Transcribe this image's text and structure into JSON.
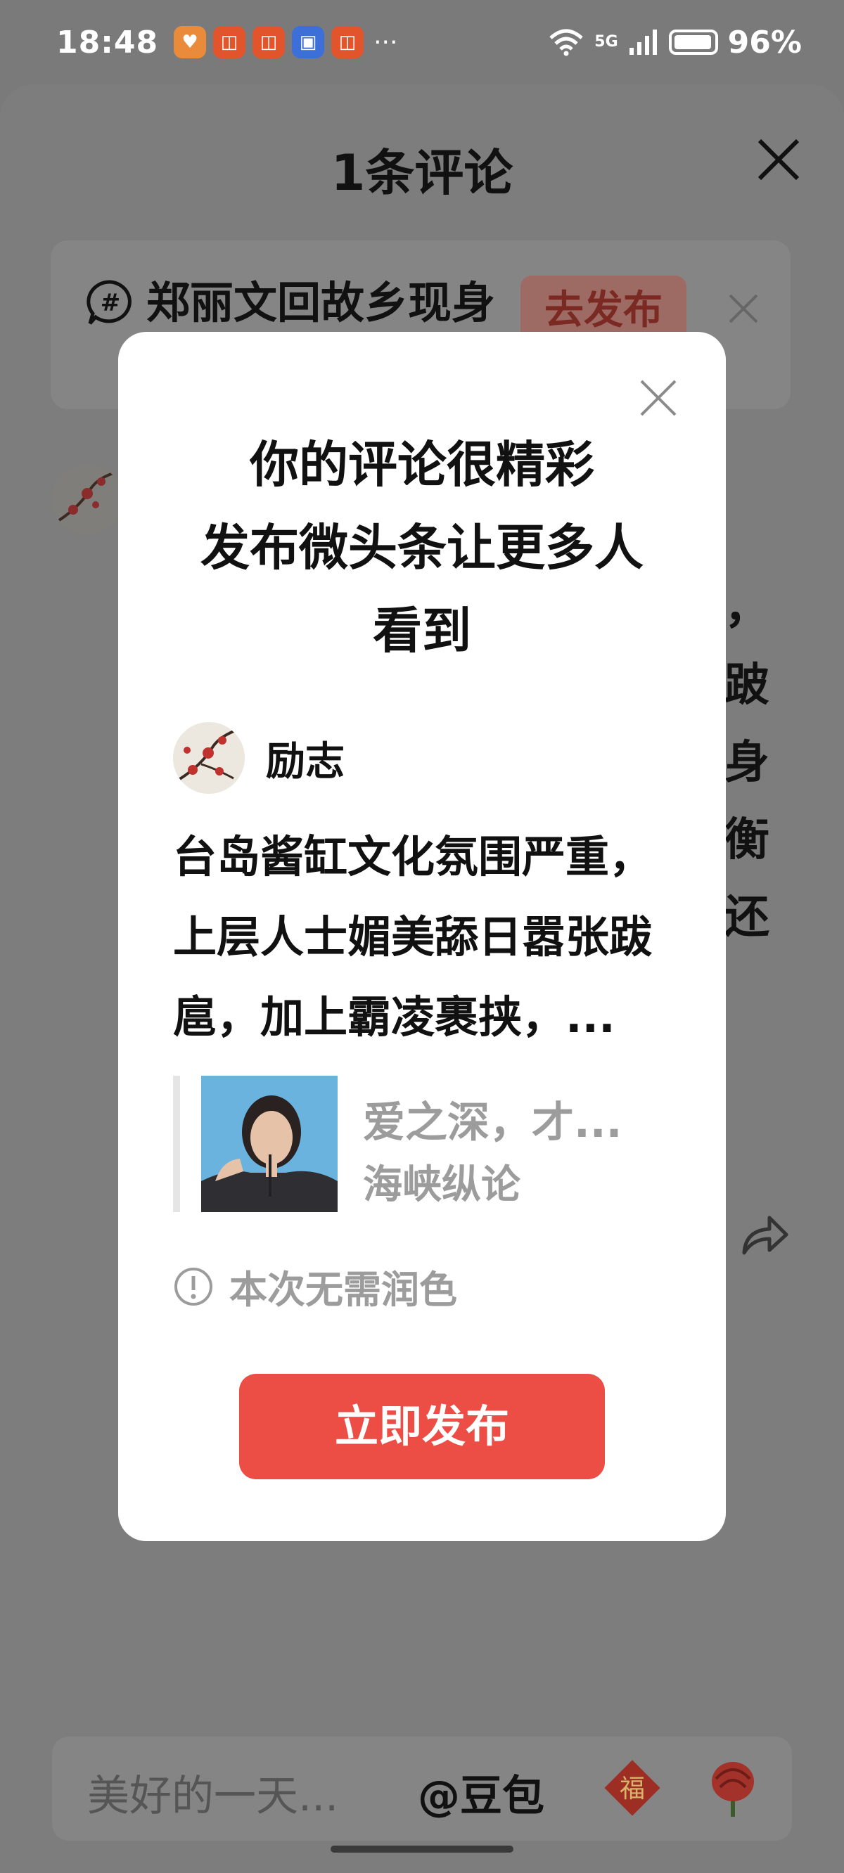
{
  "status_bar": {
    "time": "18:48",
    "network": "5G",
    "battery": "96%"
  },
  "sheet": {
    "title": "1条评论",
    "topic_text": "郑丽文回故乡现身",
    "topic_button": "去发布",
    "bg_text_right": [
      "，",
      "跛",
      "身",
      "衡",
      "还"
    ]
  },
  "modal": {
    "title_lines": [
      "你的评论很精彩",
      "发布微头条让更多人",
      "看到"
    ],
    "author_name": "励志",
    "comment_text": "台岛酱缸文化氛围严重，上层人士媚美舔日嚣张跋扈，加上霸凌裹挟，...",
    "quote_title": "爱之深，才...",
    "quote_source": "海峡纵论",
    "hint_text": "本次无需润色",
    "publish_button": "立即发布"
  },
  "comment_bar": {
    "placeholder": "美好的一天...",
    "mention": "@豆包"
  },
  "colors": {
    "accent": "#ec4e45",
    "overlay": "#7a7a7a"
  }
}
